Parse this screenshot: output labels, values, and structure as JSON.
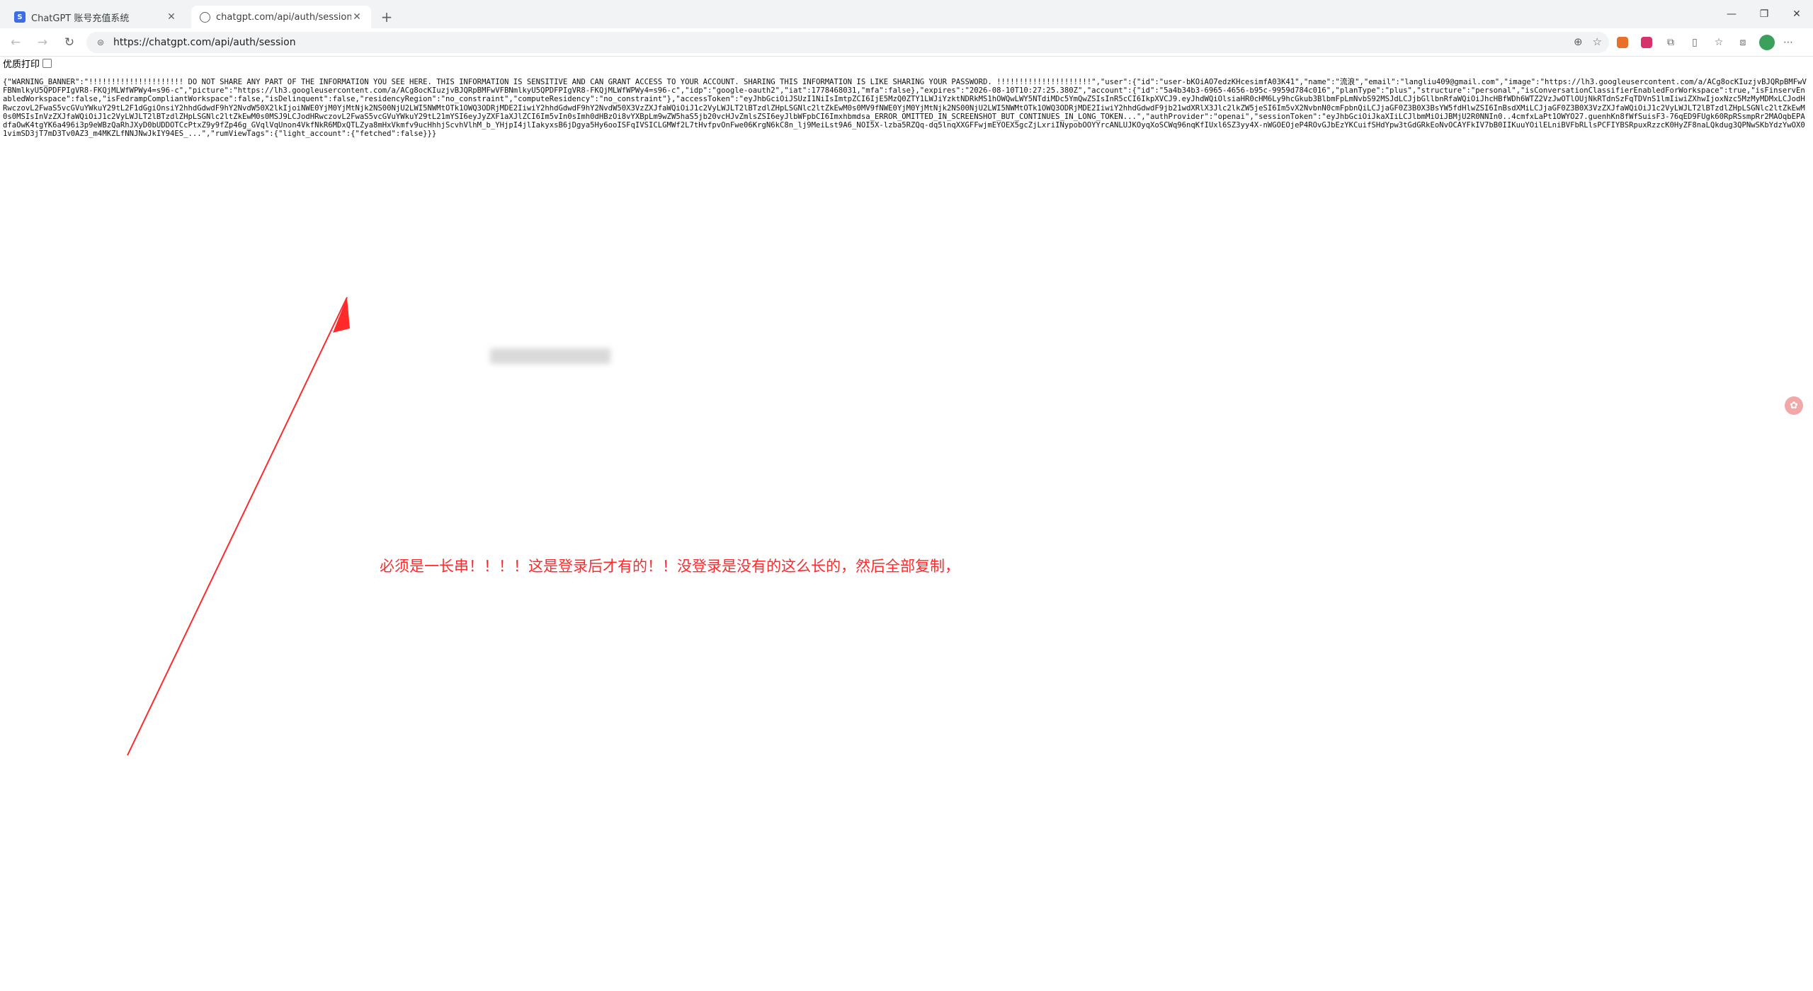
{
  "tabs": [
    {
      "title": "ChatGPT 账号充值系统",
      "icon": "chatgpt-site-icon",
      "active": false
    },
    {
      "title": "chatgpt.com/api/auth/session",
      "icon": "globe-icon",
      "active": true
    }
  ],
  "address_bar": {
    "url": "https://chatgpt.com/api/auth/session"
  },
  "page": {
    "pretty_print_label": "优质打印",
    "json_text": "{\"WARNING_BANNER\":\"!!!!!!!!!!!!!!!!!!!!! DO NOT SHARE ANY PART OF THE INFORMATION YOU SEE HERE. THIS INFORMATION IS SENSITIVE AND CAN GRANT ACCESS TO YOUR ACCOUNT. SHARING THIS INFORMATION IS LIKE SHARING YOUR PASSWORD. !!!!!!!!!!!!!!!!!!!!!\",\"user\":{\"id\":\"user-bKOiAO7edzKHcesimfA03K41\",\"name\":\"流浪\",\"email\":\"langliu409@gmail.com\",\"image\":\"https://lh3.googleusercontent.com/a/ACg8ocKIuzjvBJQRpBMFwVFBNmlkyU5QPDFPIgVR8-FKQjMLWfWPWy4=s96-c\",\"picture\":\"https://lh3.googleusercontent.com/a/ACg8ocKIuzjvBJQRpBMFwVFBNmlkyU5QPDFPIgVR8-FKQjMLWfWPWy4=s96-c\",\"idp\":\"google-oauth2\",\"iat\":1778468031,\"mfa\":false},\"expires\":\"2026-08-10T10:27:25.380Z\",\"account\":{\"id\":\"5a4b34b3-6965-4656-b95c-9959d784c016\",\"planType\":\"plus\",\"structure\":\"personal\",\"isConversationClassifierEnabledForWorkspace\":true,\"isFinservEnabledWorkspace\":false,\"isFedrampCompliantWorkspace\":false,\"isDelinquent\":false,\"residencyRegion\":\"no_constraint\",\"computeResidency\":\"no_constraint\"},\"accessToken\":\"eyJhbGciOiJSUzI1NiIsImtpZCI6IjE5MzQ0ZTY1LWJiYzktNDRkMS1hOWQwLWY5NTdiMDc5YmQwZSIsInR5cCI6IkpXVCJ9.eyJhdWQiOlsiaHR0cHM6Ly9hcGkub3BlbmFpLmNvbS92MSJdLCJjbGllbnRfaWQiOiJhcHBfWDh6WTZ2VzJwOTlOUjNkRTdnSzFqTDVnS1lmIiwiZXhwIjoxNzc5MzMyMDMxLCJodHRwczovL2FwaS5vcGVuYWkuY29tL2F1dGgiOnsiY2hhdGdwdF9hY2NvdW50X2lkIjoiNWE0YjM0YjMtNjk2NS00NjU2LWI5NWMtOTk1OWQ3ODRjMDE2IiwiY2hhdGdwdF9hY2NvdW50X3VzZXJfaWQiOiJ1c2VyLWJLT2lBTzdlZHpLSGNlc2ltZkEwM0s0MV9fNWE0YjM0YjMtNjk2NS00NjU2LWI5NWMtOTk1OWQ3ODRjMDE2IiwiY2hhdGdwdF9jb21wdXRlX3Jlc2lkZW5jeSI6Im5vX2NvbnN0cmFpbnQiLCJjaGF0Z3B0X3BsYW5fdHlwZSI6InBsdXMiLCJjaGF0Z3B0X3VzZXJfaWQiOiJ1c2VyLWJLT2lBTzdlZHpLSGNlc2ltZkEwM0s0MSIsInVzZXJfaWQiOiJ1c2VyLWJLT2lBTzdlZHpLSGNlc2ltZkEwM0s0MSJ9LCJodHRwczovL2FwaS5vcGVuYWkuY29tL21mYSI6eyJyZXF1aXJlZCI6Im5vIn0sImh0dHBzOi8vYXBpLm9wZW5haS5jb20vcHJvZmlsZSI6eyJlbWFpbCI6Imxhbmdsa_ERROR_OMITTED_IN_SCREENSHOT_BUT_CONTINUES_IN_LONG_TOKEN...\",\"authProvider\":\"openai\",\"sessionToken\":\"eyJhbGciOiJkaXIiLCJlbmMiOiJBMjU2R0NNIn0..4cmfxLaPt1OWYO27.guenhKn8fWfSuisF3-76qED9FUgk60RpRSsmpRr2MAOqbEPAdfaOwK4tgYK6a496i3p9eWBzQaRhJXyD0bUDDOTCcPtxZ9y9fZp46g_GVqlVqUnon4VkfNkR6MDxQTLZya8mHxVkmfv9ucHhhjScvhVlhM_b_YHjpI4jlIakyxsB6jDgya5Hy6ooISFqIVSICLGMWf2L7tHvfpvOnFwe06KrgN6kC8n_lj9MeiLst9A6_NOI5X-lzba5RZQq-dq5lnqXXGFFwjmEYOEX5gcZjLxriINypobOOYYrcANLUJKOyqXoSCWq96nqKfIUxl6SZ3yy4X-nWGOEOjeP4ROvGJbEzYKCuifSHdYpw3tGdGRkEoNvOCAYFkIV7bB0IIKuuYOilELniBVFbRLlsPCFIYBSRpuxRzzcK0HyZF8naLQkdug3QPNwSKbYdzYwOX01vimSD3jT7mD3Tv0AZ3_m4MKZLfNNJNwJkIY94ES_...\",\"rumViewTags\":{\"light_account\":{\"fetched\":false}}}"
  },
  "annotation": {
    "text": "必须是一长串！！！！这是登录后才有的！！没登录是没有的这么长的，然后全部复制，",
    "color": "#ff2a2a"
  }
}
